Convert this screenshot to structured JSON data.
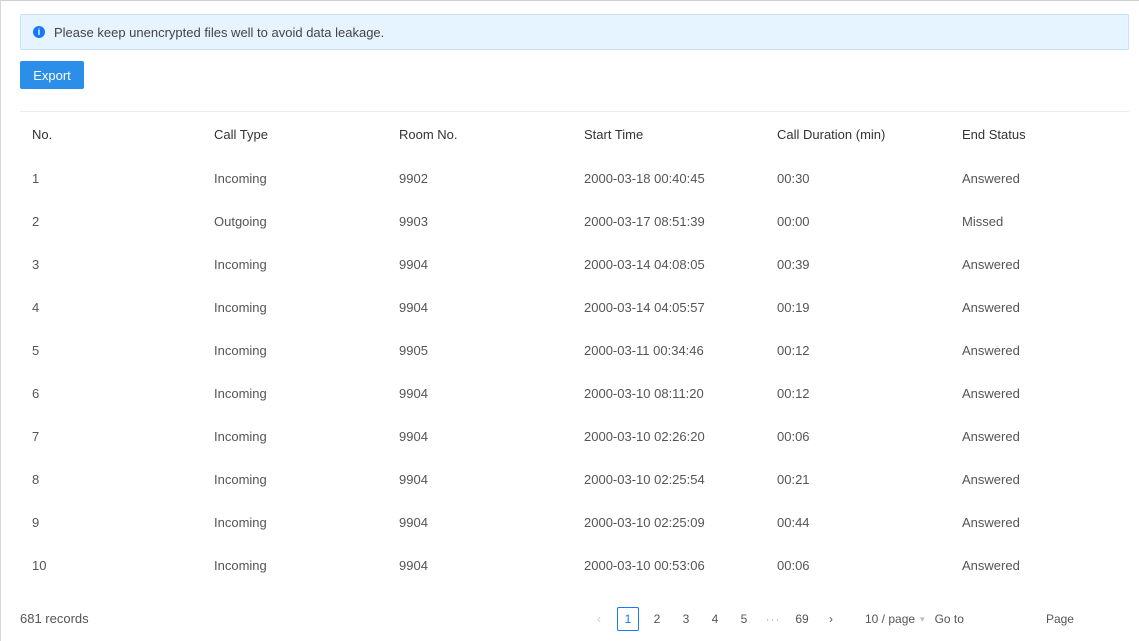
{
  "notice": {
    "icon": "info-icon",
    "text": "Please keep unencrypted files well to avoid data leakage."
  },
  "toolbar": {
    "export_label": "Export"
  },
  "table": {
    "headers": [
      "No.",
      "Call Type",
      "Room No.",
      "Start Time",
      "Call Duration (min)",
      "End Status"
    ],
    "rows": [
      [
        "1",
        "Incoming",
        "9902",
        "2000-03-18 00:40:45",
        "00:30",
        "Answered"
      ],
      [
        "2",
        "Outgoing",
        "9903",
        "2000-03-17 08:51:39",
        "00:00",
        "Missed"
      ],
      [
        "3",
        "Incoming",
        "9904",
        "2000-03-14 04:08:05",
        "00:39",
        "Answered"
      ],
      [
        "4",
        "Incoming",
        "9904",
        "2000-03-14 04:05:57",
        "00:19",
        "Answered"
      ],
      [
        "5",
        "Incoming",
        "9905",
        "2000-03-11 00:34:46",
        "00:12",
        "Answered"
      ],
      [
        "6",
        "Incoming",
        "9904",
        "2000-03-10 08:11:20",
        "00:12",
        "Answered"
      ],
      [
        "7",
        "Incoming",
        "9904",
        "2000-03-10 02:26:20",
        "00:06",
        "Answered"
      ],
      [
        "8",
        "Incoming",
        "9904",
        "2000-03-10 02:25:54",
        "00:21",
        "Answered"
      ],
      [
        "9",
        "Incoming",
        "9904",
        "2000-03-10 02:25:09",
        "00:44",
        "Answered"
      ],
      [
        "10",
        "Incoming",
        "9904",
        "2000-03-10 00:53:06",
        "00:06",
        "Answered"
      ]
    ]
  },
  "footer": {
    "total": "681 records",
    "prev_icon": "chevron-left-icon",
    "next_icon": "chevron-right-icon",
    "pages": [
      "1",
      "2",
      "3",
      "4",
      "5"
    ],
    "current_page": "1",
    "ellipsis": "···",
    "last_page": "69",
    "page_size": "10 / page",
    "goto_label": "Go to",
    "page_label": "Page"
  },
  "colors": {
    "accent": "#1677ff",
    "button": "#2b8fea",
    "notice_bg": "#e6f4ff"
  }
}
